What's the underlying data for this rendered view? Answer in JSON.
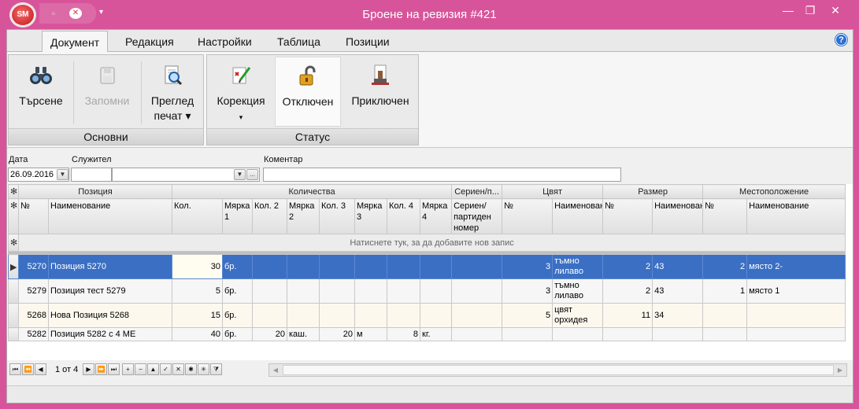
{
  "window": {
    "title": "Броене на ревизия #421",
    "logo_text": "SM",
    "controls": [
      "—",
      "❐",
      "✕"
    ]
  },
  "qat": {
    "arrow": "▾"
  },
  "menu": {
    "tabs": [
      {
        "label": "Документ",
        "active": true
      },
      {
        "label": "Редакция"
      },
      {
        "label": "Настройки"
      },
      {
        "label": "Таблица"
      },
      {
        "label": "Позиции"
      }
    ],
    "help": "?"
  },
  "ribbon": {
    "groups": [
      {
        "label": "Основни",
        "buttons": [
          {
            "label": "Търсене",
            "icon": "binoculars-icon"
          },
          {
            "label": "Запомни",
            "icon": "save-disk-icon",
            "disabled": true
          },
          {
            "label": "Преглед печат ▾",
            "line1": "Преглед",
            "line2": "печат ▾",
            "icon": "print-preview-icon"
          }
        ]
      },
      {
        "label": "Статус",
        "buttons": [
          {
            "label": "Корекция",
            "line1": "Корекция",
            "line2": "▾",
            "icon": "correction-icon"
          },
          {
            "label": "Отключен",
            "icon": "unlocked-padlock-icon",
            "pressed": true
          },
          {
            "label": "Приключен",
            "icon": "stamp-icon"
          }
        ]
      }
    ]
  },
  "filters": {
    "date_label": "Дата",
    "date_value": "26.09.2016",
    "employee_label": "Служител",
    "employee_code": "",
    "employee_name": "",
    "ellipsis": "...",
    "comment_label": "Коментар",
    "comment_value": ""
  },
  "grid": {
    "bands": [
      "Позиция",
      "Количества",
      "Сериен/п...",
      "Цвят",
      "Размер",
      "Местоположение"
    ],
    "columns": [
      "№",
      "Наименование",
      "Кол.",
      "Мярка 1",
      "Кол. 2",
      "Мярка 2",
      "Кол. 3",
      "Мярка 3",
      "Кол. 4",
      "Мярка 4",
      "Сериен/партиден номер",
      "№",
      "Наименование",
      "№",
      "Наименование",
      "№",
      "Наименование"
    ],
    "new_row_hint": "Натиснете тук, за да добавите нов запис",
    "rows": [
      {
        "no": "5270",
        "name": "Позиция 5270",
        "qty": "30",
        "u1": "бр.",
        "q2": "",
        "u2": "",
        "q3": "",
        "u3": "",
        "q4": "",
        "u4": "",
        "serial": "",
        "color_no": "3",
        "color": "тъмно лилаво",
        "size_no": "2",
        "size": "43",
        "loc_no": "2",
        "loc": "място 2-",
        "selected": true
      },
      {
        "no": "5279",
        "name": "Позиция тест 5279",
        "qty": "5",
        "u1": "бр.",
        "q2": "",
        "u2": "",
        "q3": "",
        "u3": "",
        "q4": "",
        "u4": "",
        "serial": "",
        "color_no": "3",
        "color": "тъмно лилаво",
        "size_no": "2",
        "size": "43",
        "loc_no": "1",
        "loc": "място 1"
      },
      {
        "no": "5268",
        "name": "Нова Позиция 5268",
        "qty": "15",
        "u1": "бр.",
        "q2": "",
        "u2": "",
        "q3": "",
        "u3": "",
        "q4": "",
        "u4": "",
        "serial": "",
        "color_no": "5",
        "color": "цвят орхидея",
        "size_no": "11",
        "size": "34",
        "loc_no": "",
        "loc": ""
      },
      {
        "no": "5282",
        "name": "Позиция 5282 с 4 МЕ",
        "qty": "40",
        "u1": "бр.",
        "q2": "20",
        "u2": "каш.",
        "q3": "20",
        "u3": "м",
        "q4": "8",
        "u4": "кг.",
        "serial": "",
        "color_no": "",
        "color": "",
        "size_no": "",
        "size": "",
        "loc_no": "",
        "loc": ""
      }
    ]
  },
  "navigator": {
    "record_text": "1 от 4",
    "buttons": [
      "⏮",
      "⏪",
      "◀",
      "▶",
      "⏩",
      "⏭",
      "+",
      "−",
      "▲",
      "✓",
      "✕",
      "✱",
      "✳",
      "⧩"
    ]
  }
}
